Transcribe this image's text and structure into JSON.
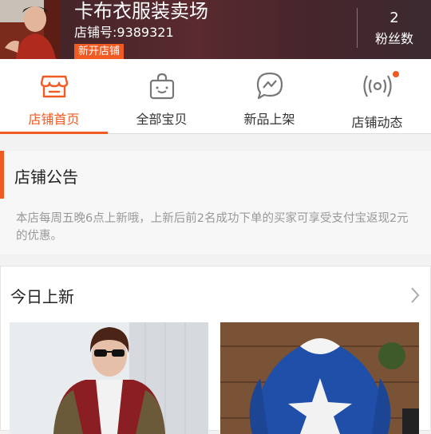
{
  "header": {
    "shop_name": "卡布衣服装卖场",
    "shop_id": "店铺号:9389321",
    "badge": "新开店铺",
    "fans_count": "2",
    "fans_label": "粉丝数"
  },
  "tabs": [
    {
      "label": "店铺首页",
      "icon": "storefront-icon",
      "active": true
    },
    {
      "label": "全部宝贝",
      "icon": "shopping-bag-icon",
      "active": false
    },
    {
      "label": "新品上架",
      "icon": "chat-bubble-icon",
      "active": false
    },
    {
      "label": "店铺动态",
      "icon": "broadcast-icon",
      "active": false,
      "has_dot": true
    }
  ],
  "notice": {
    "title": "店铺公告",
    "text": "本店每周五晚6点上新哦，上新后前2名成功下单的买家可享受支付宝返现2元的优惠。"
  },
  "today": {
    "title": "今日上新"
  },
  "colors": {
    "accent": "#f15a22",
    "text_muted": "#999999"
  }
}
